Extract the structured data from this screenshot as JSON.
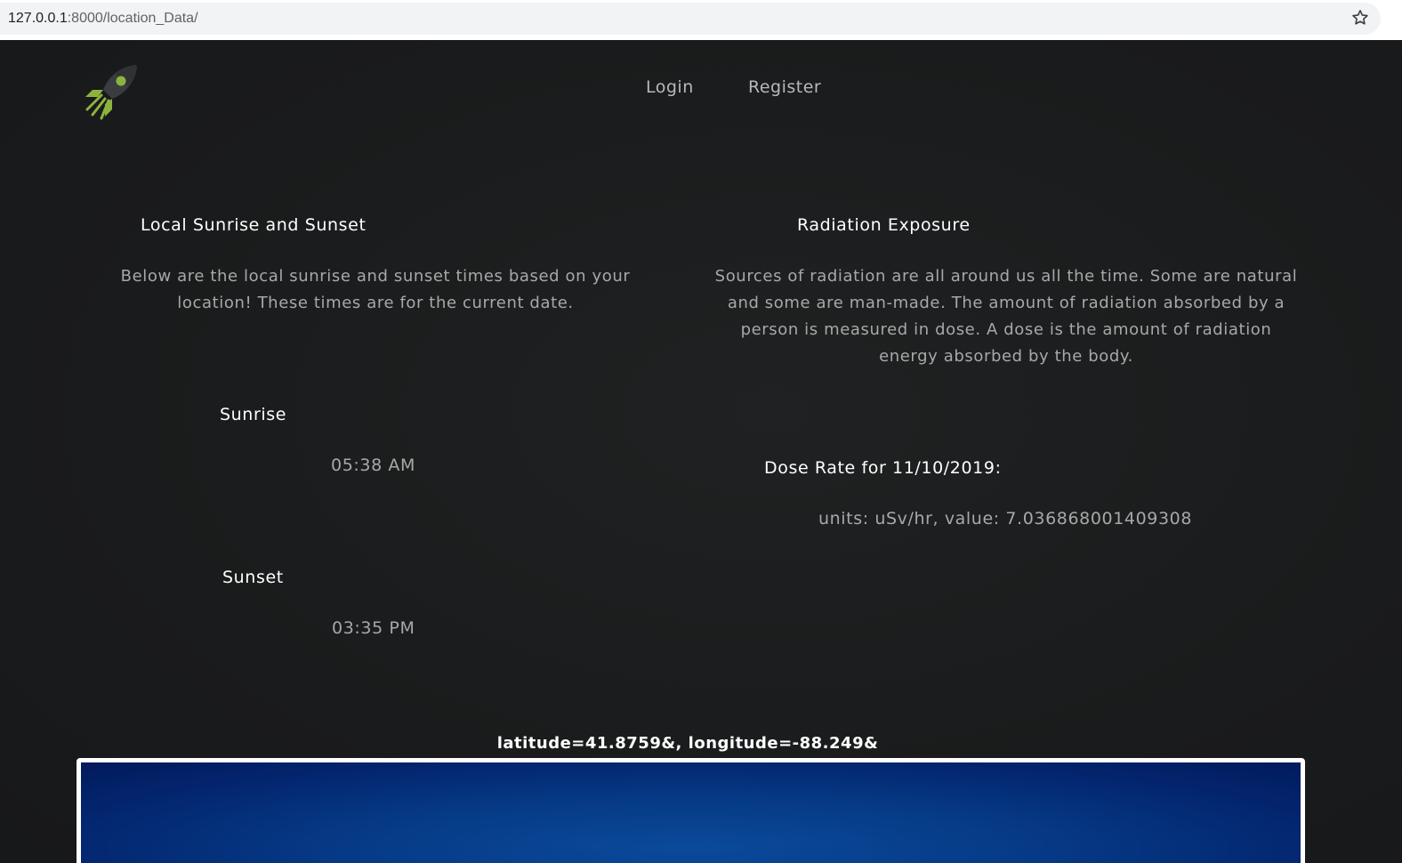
{
  "browser": {
    "url_host": "127.0.0.1",
    "url_rest": ":8000/location_Data/",
    "bookmark_icon": "star-icon"
  },
  "nav": {
    "logo_icon": "rocket-icon",
    "login": "Login",
    "register": "Register"
  },
  "sun": {
    "title": "Local Sunrise and Sunset",
    "description": "Below are the local sunrise and sunset times based on your location! These times are for the current date.",
    "sunrise_label": "Sunrise",
    "sunrise_time": "05:38 AM",
    "sunset_label": "Sunset",
    "sunset_time": "03:35 PM"
  },
  "radiation": {
    "title": "Radiation Exposure",
    "description": "Sources of radiation are all around us all the time. Some are natural and some are man-made. The amount of radiation absorbed by a person is measured in dose. A dose is the amount of radiation energy absorbed by the body.",
    "dose_label": "Dose Rate for 11/10/2019:",
    "dose_value": "units: uSv/hr, value: 7.036868001409308"
  },
  "location": {
    "coords": "latitude=41.8759&, longitude=-88.249&"
  },
  "colors": {
    "background": "#1a1b1c",
    "accent_green": "#8db33f",
    "map_blue": "#063a86"
  }
}
